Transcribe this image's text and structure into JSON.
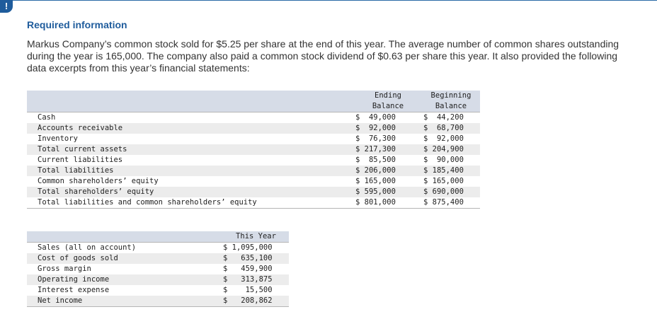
{
  "alert_symbol": "!",
  "heading": "Required information",
  "intro": "Markus Company’s common stock sold for $5.25 per share at the end of this year. The average number of common shares outstanding during the year is 165,000. The company also paid a common stock dividend of $0.63 per share this year. It also provided the following data excerpts from this year’s financial statements:",
  "balance_sheet": {
    "col_ending_line1": "Ending",
    "col_ending_line2": "Balance",
    "col_beginning_line1": "Beginning",
    "col_beginning_line2": "Balance",
    "rows": [
      {
        "label": "Cash",
        "ending": "$  49,000",
        "beginning": "$  44,200"
      },
      {
        "label": "Accounts receivable",
        "ending": "$  92,000",
        "beginning": "$  68,700"
      },
      {
        "label": "Inventory",
        "ending": "$  76,300",
        "beginning": "$  92,000"
      },
      {
        "label": "Total current assets",
        "ending": "$ 217,300",
        "beginning": "$ 204,900"
      },
      {
        "label": "Current liabilities",
        "ending": "$  85,500",
        "beginning": "$  90,000"
      },
      {
        "label": "Total liabilities",
        "ending": "$ 206,000",
        "beginning": "$ 185,400"
      },
      {
        "label": "Common shareholders’ equity",
        "ending": "$ 165,000",
        "beginning": "$ 165,000"
      },
      {
        "label": "Total shareholders’ equity",
        "ending": "$ 595,000",
        "beginning": "$ 690,000"
      },
      {
        "label": "Total liabilities and common shareholders’ equity",
        "ending": "$ 801,000",
        "beginning": "$ 875,400"
      }
    ]
  },
  "income_statement": {
    "col_this_year": "This Year",
    "rows": [
      {
        "label": "Sales (all on account)",
        "value": "$ 1,095,000"
      },
      {
        "label": "Cost of goods sold",
        "value": "$   635,100"
      },
      {
        "label": "Gross margin",
        "value": "$   459,900"
      },
      {
        "label": "Operating income",
        "value": "$   313,875"
      },
      {
        "label": "Interest expense",
        "value": "$    15,500"
      },
      {
        "label": "Net income",
        "value": "$   208,862"
      }
    ]
  }
}
